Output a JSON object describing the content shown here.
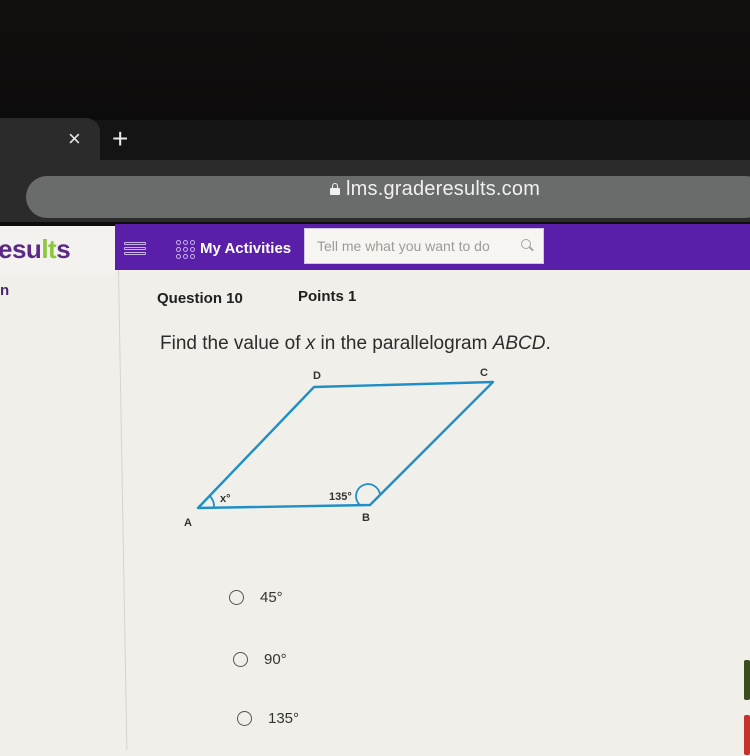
{
  "browser": {
    "tab_close_glyph": "×",
    "new_tab_glyph": "+",
    "url": "lms.graderesults.com"
  },
  "app": {
    "logo_part1": "esu",
    "logo_part2": "lt",
    "logo_part3": "s",
    "logo_sub": "n",
    "nav": {
      "my_activities_label": "My Activities",
      "search_placeholder": "Tell me what you want to do"
    },
    "colors": {
      "nav_purple": "#5a1fa8",
      "diagram_blue": "#1f8fc7",
      "logo_green": "#8cc63f"
    }
  },
  "question": {
    "number_label": "Question 10",
    "points_label": "Points 1",
    "text_prefix": "Find the value of ",
    "text_var": "x",
    "text_middle": " in the parallelogram ",
    "text_shape": "ABCD",
    "text_suffix": ".",
    "figure": {
      "vertices": [
        "A",
        "B",
        "C",
        "D"
      ],
      "angle_A_label": "x°",
      "angle_B_label": "135°"
    },
    "options": [
      {
        "label": "45°",
        "selected": false
      },
      {
        "label": "90°",
        "selected": false
      },
      {
        "label": "135°",
        "selected": false
      }
    ]
  }
}
